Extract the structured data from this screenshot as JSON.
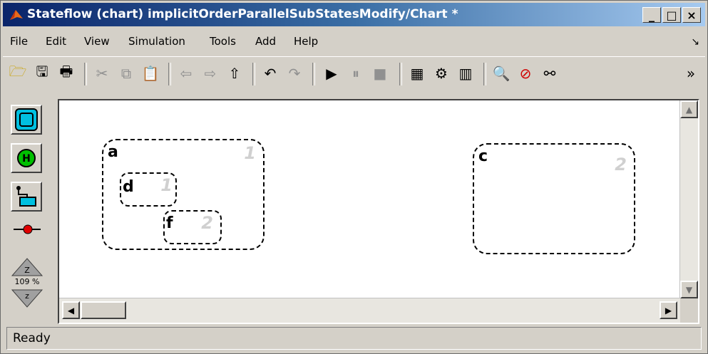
{
  "window": {
    "title": "Stateflow (chart) implicitOrderParallelSubStatesModify/Chart *",
    "buttons": {
      "minimize": "_",
      "maximize": "□",
      "close": "×"
    }
  },
  "menu": [
    "File",
    "Edit",
    "View",
    "Simulation",
    "Tools",
    "Add",
    "Help"
  ],
  "menu_extra": "»",
  "toolbar": {
    "overflow": "»"
  },
  "palette": {
    "zoom_label": "109 %",
    "zoom_in": "Z",
    "zoom_out": "z"
  },
  "states": [
    {
      "label": "a",
      "order": "1"
    },
    {
      "label": "d",
      "order": "1"
    },
    {
      "label": "f",
      "order": "2"
    },
    {
      "label": "c",
      "order": "2"
    }
  ],
  "status": "Ready"
}
